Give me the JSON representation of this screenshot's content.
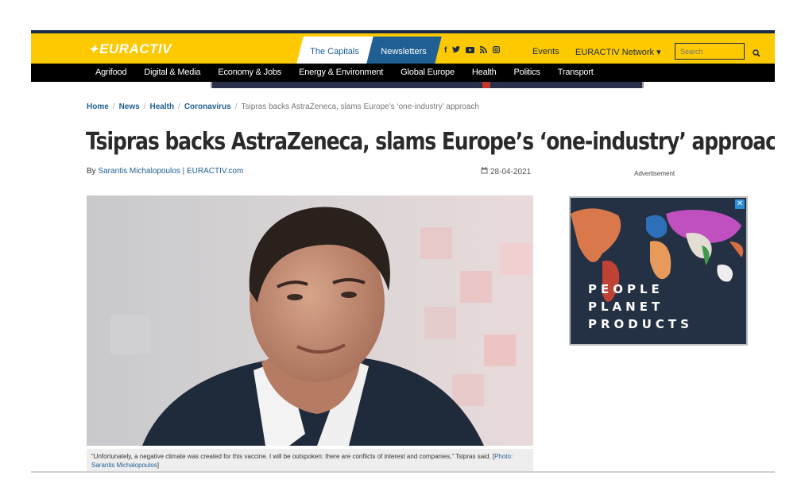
{
  "header": {
    "logo": "EURACTIV",
    "capitals": "The Capitals",
    "newsletters": "Newsletters",
    "social_icons": [
      "facebook-icon",
      "twitter-icon",
      "youtube-icon",
      "rss-icon",
      "instagram-icon"
    ],
    "events": "Events",
    "network": "EURACTIV Network ▾",
    "search_placeholder": "Search"
  },
  "nav": {
    "items": [
      "Agrifood",
      "Digital & Media",
      "Economy & Jobs",
      "Energy & Environment",
      "Global Europe",
      "Health",
      "Politics",
      "Transport"
    ]
  },
  "breadcrumb": {
    "items": [
      "Home",
      "News",
      "Health",
      "Coronavirus"
    ],
    "current": "Tsipras backs AstraZeneca, slams Europe's ‘one-industry’ approach"
  },
  "article": {
    "title": "Tsipras backs AstraZeneca, slams Europe’s ‘one-industry’ approach",
    "by": "By",
    "author": "Sarantis Michalopoulos | EURACTIV.com",
    "date": "28-04-2021",
    "caption": "“Unfortunately, a negative climate was created for this vaccine. I will be outspoken: there are conflicts of interest and companies,” Tsipras said. [",
    "credit": "Photo: Sarantis Michalopoulos",
    "caption_end": "]"
  },
  "sidebar": {
    "ad_label": "Advertisement",
    "ad_lines": [
      "PEOPLE",
      "PLANET",
      "PRODUCTS"
    ]
  },
  "colors": {
    "brand_yellow": "#fdc900",
    "navy": "#1b2a4a",
    "link_blue": "#1f5f93"
  }
}
